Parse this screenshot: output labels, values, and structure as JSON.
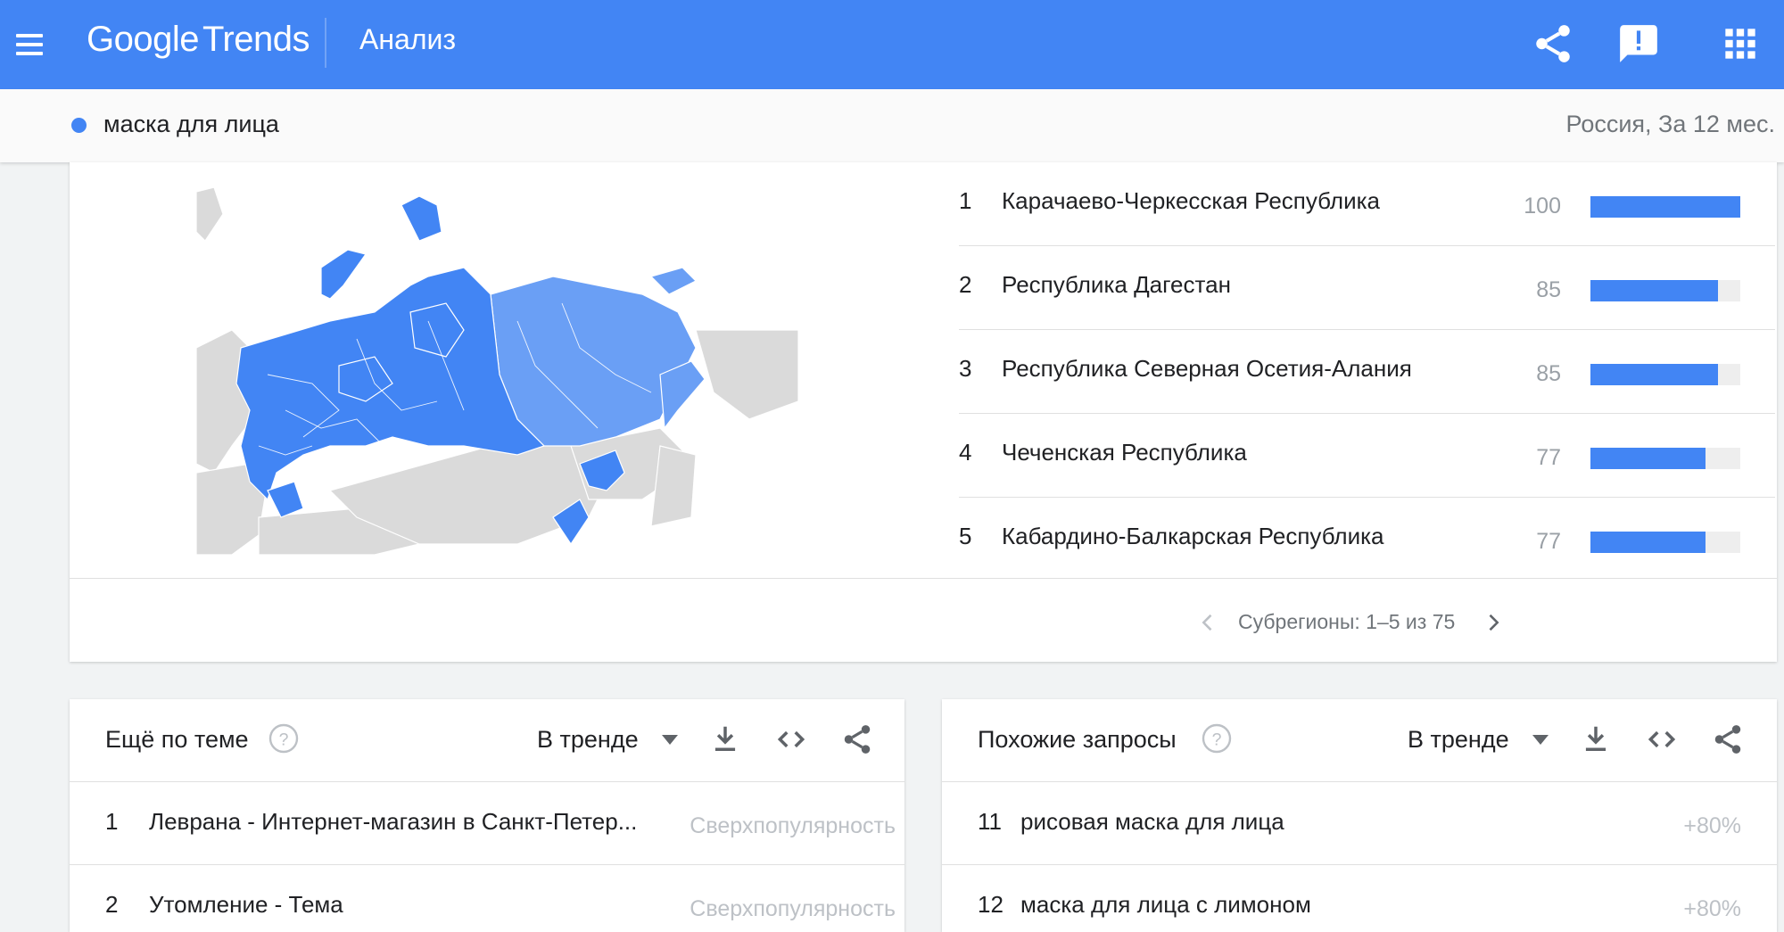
{
  "header": {
    "logo_google": "Google",
    "logo_trends": "Trends",
    "page_name": "Анализ",
    "icons": [
      "menu-icon",
      "share-icon",
      "feedback-icon",
      "apps-icon"
    ]
  },
  "summary": {
    "term": "маска для лица",
    "term_color": "#4285f4",
    "region_period": "Россия, За 12 мес."
  },
  "regions": {
    "items": [
      {
        "rank": "1",
        "name": "Карачаево-Черкесская Республика",
        "value": "100",
        "level": 100
      },
      {
        "rank": "2",
        "name": "Республика Дагестан",
        "value": "85",
        "level": 85
      },
      {
        "rank": "3",
        "name": "Республика Северная Осетия-Алания",
        "value": "85",
        "level": 85
      },
      {
        "rank": "4",
        "name": "Чеченская Республика",
        "value": "77",
        "level": 77
      },
      {
        "rank": "5",
        "name": "Кабардино-Балкарская Республика",
        "value": "77",
        "level": 77
      }
    ],
    "pager_text": "Субрегионы: 1–5 из 75"
  },
  "related_topics": {
    "title": "Ещё по теме",
    "sort": "В тренде",
    "rows": [
      {
        "num": "1",
        "text": "Леврана - Интернет-магазин в Санкт-Петер...",
        "value": "Сверхпопулярность"
      },
      {
        "num": "2",
        "text": "Утомление - Тема",
        "value": "Сверхпопулярность"
      }
    ]
  },
  "related_queries": {
    "title": "Похожие запросы",
    "sort": "В тренде",
    "rows": [
      {
        "num": "11",
        "text": "рисовая маска для лица",
        "value": "+80%"
      },
      {
        "num": "12",
        "text": "маска для лица с лимоном",
        "value": "+80%"
      }
    ]
  },
  "colors": {
    "accent": "#4285f4",
    "map_high": "#4285f4",
    "map_mid": "#6a9ff5",
    "map_other": "#dadada"
  }
}
